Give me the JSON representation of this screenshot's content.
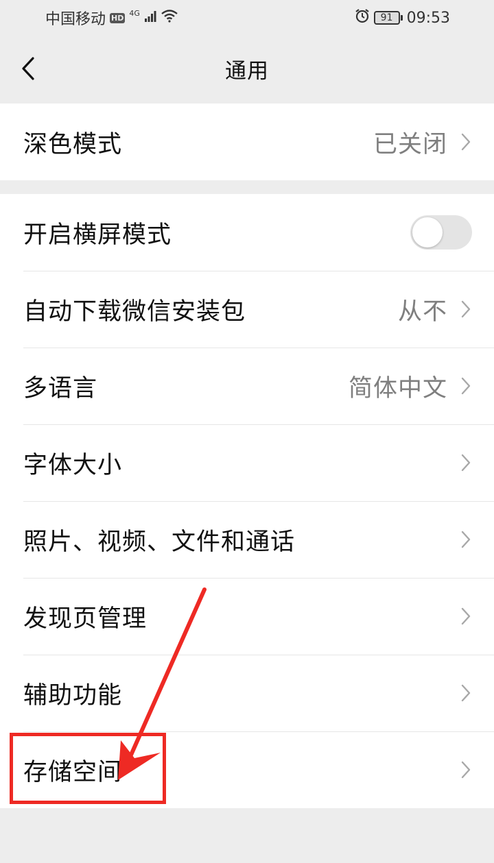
{
  "status_bar": {
    "carrier": "中国移动",
    "hd": "HD",
    "network": "4G",
    "battery": "91",
    "time": "09:53"
  },
  "navbar": {
    "title": "通用"
  },
  "group1": {
    "dark_mode": {
      "label": "深色模式",
      "value": "已关闭"
    }
  },
  "group2": {
    "landscape": {
      "label": "开启横屏模式",
      "enabled": false
    },
    "auto_download": {
      "label": "自动下载微信安装包",
      "value": "从不"
    },
    "language": {
      "label": "多语言",
      "value": "简体中文"
    },
    "font_size": {
      "label": "字体大小"
    },
    "media": {
      "label": "照片、视频、文件和通话"
    },
    "discover": {
      "label": "发现页管理"
    },
    "accessibility": {
      "label": "辅助功能"
    },
    "storage": {
      "label": "存储空间"
    }
  },
  "colors": {
    "annotation": "#ee2a24",
    "background": "#ededed",
    "secondary_text": "#7f7f7f"
  }
}
